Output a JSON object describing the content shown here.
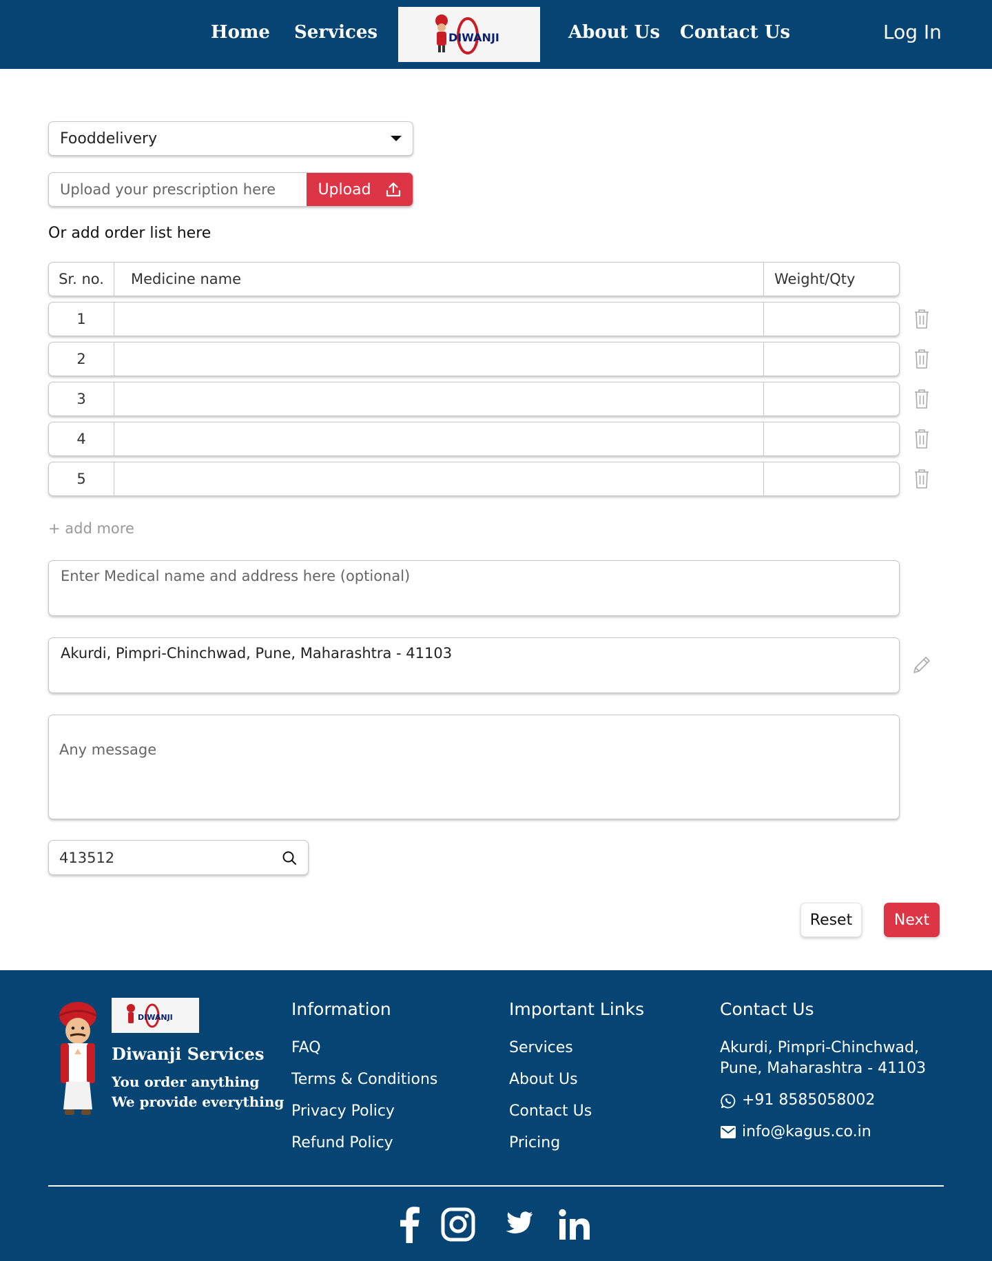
{
  "nav": {
    "links": [
      "Home",
      "Services",
      "About Us",
      "Contact Us"
    ],
    "logo_text": "DIWANJI",
    "login": "Log In"
  },
  "form": {
    "service_select": "Fooddelivery",
    "upload_placeholder": "Upload your prescription here",
    "upload_button": "Upload",
    "or_text": "Or add order list here",
    "table": {
      "headers": [
        "Sr. no.",
        "Medicine name",
        "Weight/Qty"
      ],
      "rows": [
        "1",
        "2",
        "3",
        "4",
        "5"
      ]
    },
    "add_more": "+ add more",
    "medical_placeholder": "Enter Medical name and address here (optional)",
    "address_value": "Akurdi, Pimpri-Chinchwad, Pune, Maharashtra - 41103",
    "message_placeholder": "Any message",
    "pincode_value": "413512",
    "reset_button": "Reset",
    "next_button": "Next"
  },
  "footer": {
    "brand": "Diwanji Services",
    "tagline_1": "You order anything",
    "tagline_2": "We provide everything",
    "information": {
      "heading": "Information",
      "links": [
        "FAQ",
        "Terms & Conditions",
        "Privacy Policy",
        "Refund Policy"
      ]
    },
    "important_links": {
      "heading": "Important Links",
      "links": [
        "Services",
        "About Us",
        "Contact Us",
        "Pricing"
      ]
    },
    "contact": {
      "heading": "Contact Us",
      "address_line_1": "Akurdi, Pimpri-Chinchwad,",
      "address_line_2": "Pune, Maharashtra - 41103",
      "phone": "+91 8585058002",
      "email": "info@kagus.co.in"
    },
    "social": [
      "facebook-icon",
      "instagram-icon",
      "twitter-icon",
      "linkedin-icon"
    ]
  },
  "colors": {
    "navy": "#064473",
    "accent_red": "#dc3545",
    "white": "#ffffff"
  }
}
